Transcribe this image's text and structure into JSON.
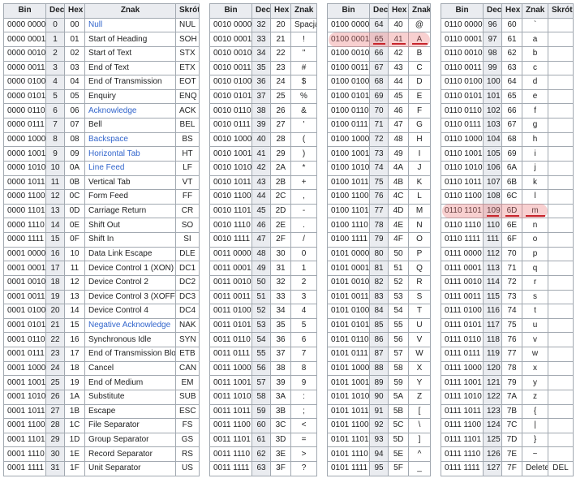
{
  "tables": [
    {
      "headers": [
        "Bin",
        "Dec",
        "Hex",
        "Znak",
        "Skrót"
      ],
      "rows": [
        [
          "0000 0000",
          "0",
          "00",
          "Null",
          "NUL"
        ],
        [
          "0000 0001",
          "1",
          "01",
          "Start of Heading",
          "SOH"
        ],
        [
          "0000 0010",
          "2",
          "02",
          "Start of Text",
          "STX"
        ],
        [
          "0000 0011",
          "3",
          "03",
          "End of Text",
          "ETX"
        ],
        [
          "0000 0100",
          "4",
          "04",
          "End of Transmission",
          "EOT"
        ],
        [
          "0000 0101",
          "5",
          "05",
          "Enquiry",
          "ENQ"
        ],
        [
          "0000 0110",
          "6",
          "06",
          "Acknowledge",
          "ACK"
        ],
        [
          "0000 0111",
          "7",
          "07",
          "Bell",
          "BEL"
        ],
        [
          "0000 1000",
          "8",
          "08",
          "Backspace",
          "BS"
        ],
        [
          "0000 1001",
          "9",
          "09",
          "Horizontal Tab",
          "HT"
        ],
        [
          "0000 1010",
          "10",
          "0A",
          "Line Feed",
          "LF"
        ],
        [
          "0000 1011",
          "11",
          "0B",
          "Vertical Tab",
          "VT"
        ],
        [
          "0000 1100",
          "12",
          "0C",
          "Form Feed",
          "FF"
        ],
        [
          "0000 1101",
          "13",
          "0D",
          "Carriage Return",
          "CR"
        ],
        [
          "0000 1110",
          "14",
          "0E",
          "Shift Out",
          "SO"
        ],
        [
          "0000 1111",
          "15",
          "0F",
          "Shift In",
          "SI"
        ],
        [
          "0001 0000",
          "16",
          "10",
          "Data Link Escape",
          "DLE"
        ],
        [
          "0001 0001",
          "17",
          "11",
          "Device Control 1 (XON)",
          "DC1"
        ],
        [
          "0001 0010",
          "18",
          "12",
          "Device Control 2",
          "DC2"
        ],
        [
          "0001 0011",
          "19",
          "13",
          "Device Control 3 (XOFF)",
          "DC3"
        ],
        [
          "0001 0100",
          "20",
          "14",
          "Device Control 4",
          "DC4"
        ],
        [
          "0001 0101",
          "21",
          "15",
          "Negative Acknowledge",
          "NAK"
        ],
        [
          "0001 0110",
          "22",
          "16",
          "Synchronous Idle",
          "SYN"
        ],
        [
          "0001 0111",
          "23",
          "17",
          "End of Transmission Block",
          "ETB"
        ],
        [
          "0001 1000",
          "24",
          "18",
          "Cancel",
          "CAN"
        ],
        [
          "0001 1001",
          "25",
          "19",
          "End of Medium",
          "EM"
        ],
        [
          "0001 1010",
          "26",
          "1A",
          "Substitute",
          "SUB"
        ],
        [
          "0001 1011",
          "27",
          "1B",
          "Escape",
          "ESC"
        ],
        [
          "0001 1100",
          "28",
          "1C",
          "File Separator",
          "FS"
        ],
        [
          "0001 1101",
          "29",
          "1D",
          "Group Separator",
          "GS"
        ],
        [
          "0001 1110",
          "30",
          "1E",
          "Record Separator",
          "RS"
        ],
        [
          "0001 1111",
          "31",
          "1F",
          "Unit Separator",
          "US"
        ]
      ],
      "linked_rows": [
        0,
        6,
        8,
        9,
        10,
        21
      ]
    },
    {
      "headers": [
        "Bin",
        "Dec",
        "Hex",
        "Znak"
      ],
      "rows": [
        [
          "0010 0000",
          "32",
          "20",
          "Spacja"
        ],
        [
          "0010 0001",
          "33",
          "21",
          "!"
        ],
        [
          "0010 0010",
          "34",
          "22",
          "\""
        ],
        [
          "0010 0011",
          "35",
          "23",
          "#"
        ],
        [
          "0010 0100",
          "36",
          "24",
          "$"
        ],
        [
          "0010 0101",
          "37",
          "25",
          "%"
        ],
        [
          "0010 0110",
          "38",
          "26",
          "&"
        ],
        [
          "0010 0111",
          "39",
          "27",
          "'"
        ],
        [
          "0010 1000",
          "40",
          "28",
          "("
        ],
        [
          "0010 1001",
          "41",
          "29",
          ")"
        ],
        [
          "0010 1010",
          "42",
          "2A",
          "*"
        ],
        [
          "0010 1011",
          "43",
          "2B",
          "+"
        ],
        [
          "0010 1100",
          "44",
          "2C",
          ","
        ],
        [
          "0010 1101",
          "45",
          "2D",
          "-"
        ],
        [
          "0010 1110",
          "46",
          "2E",
          "."
        ],
        [
          "0010 1111",
          "47",
          "2F",
          "/"
        ],
        [
          "0011 0000",
          "48",
          "30",
          "0"
        ],
        [
          "0011 0001",
          "49",
          "31",
          "1"
        ],
        [
          "0011 0010",
          "50",
          "32",
          "2"
        ],
        [
          "0011 0011",
          "51",
          "33",
          "3"
        ],
        [
          "0011 0100",
          "52",
          "34",
          "4"
        ],
        [
          "0011 0101",
          "53",
          "35",
          "5"
        ],
        [
          "0011 0110",
          "54",
          "36",
          "6"
        ],
        [
          "0011 0111",
          "55",
          "37",
          "7"
        ],
        [
          "0011 1000",
          "56",
          "38",
          "8"
        ],
        [
          "0011 1001",
          "57",
          "39",
          "9"
        ],
        [
          "0011 1010",
          "58",
          "3A",
          ":"
        ],
        [
          "0011 1011",
          "59",
          "3B",
          ";"
        ],
        [
          "0011 1100",
          "60",
          "3C",
          "<"
        ],
        [
          "0011 1101",
          "61",
          "3D",
          "="
        ],
        [
          "0011 1110",
          "62",
          "3E",
          ">"
        ],
        [
          "0011 1111",
          "63",
          "3F",
          "?"
        ]
      ],
      "linked_rows": []
    },
    {
      "headers": [
        "Bin",
        "Dec",
        "Hex",
        "Znak"
      ],
      "rows": [
        [
          "0100 0000",
          "64",
          "40",
          "@"
        ],
        [
          "0100 0001",
          "65",
          "41",
          "A"
        ],
        [
          "0100 0010",
          "66",
          "42",
          "B"
        ],
        [
          "0100 0011",
          "67",
          "43",
          "C"
        ],
        [
          "0100 0100",
          "68",
          "44",
          "D"
        ],
        [
          "0100 0101",
          "69",
          "45",
          "E"
        ],
        [
          "0100 0110",
          "70",
          "46",
          "F"
        ],
        [
          "0100 0111",
          "71",
          "47",
          "G"
        ],
        [
          "0100 1000",
          "72",
          "48",
          "H"
        ],
        [
          "0100 1001",
          "73",
          "49",
          "I"
        ],
        [
          "0100 1010",
          "74",
          "4A",
          "J"
        ],
        [
          "0100 1011",
          "75",
          "4B",
          "K"
        ],
        [
          "0100 1100",
          "76",
          "4C",
          "L"
        ],
        [
          "0100 1101",
          "77",
          "4D",
          "M"
        ],
        [
          "0100 1110",
          "78",
          "4E",
          "N"
        ],
        [
          "0100 1111",
          "79",
          "4F",
          "O"
        ],
        [
          "0101 0000",
          "80",
          "50",
          "P"
        ],
        [
          "0101 0001",
          "81",
          "51",
          "Q"
        ],
        [
          "0101 0010",
          "82",
          "52",
          "R"
        ],
        [
          "0101 0011",
          "83",
          "53",
          "S"
        ],
        [
          "0101 0100",
          "84",
          "54",
          "T"
        ],
        [
          "0101 0101",
          "85",
          "55",
          "U"
        ],
        [
          "0101 0110",
          "86",
          "56",
          "V"
        ],
        [
          "0101 0111",
          "87",
          "57",
          "W"
        ],
        [
          "0101 1000",
          "88",
          "58",
          "X"
        ],
        [
          "0101 1001",
          "89",
          "59",
          "Y"
        ],
        [
          "0101 1010",
          "90",
          "5A",
          "Z"
        ],
        [
          "0101 1011",
          "91",
          "5B",
          "["
        ],
        [
          "0101 1100",
          "92",
          "5C",
          "\\"
        ],
        [
          "0101 1101",
          "93",
          "5D",
          "]"
        ],
        [
          "0101 1110",
          "94",
          "5E",
          "^"
        ],
        [
          "0101 1111",
          "95",
          "5F",
          "_"
        ]
      ],
      "linked_rows": []
    },
    {
      "headers": [
        "Bin",
        "Dec",
        "Hex",
        "Znak",
        "Skrót"
      ],
      "rows": [
        [
          "0110 0000",
          "96",
          "60",
          "`",
          ""
        ],
        [
          "0110 0001",
          "97",
          "61",
          "a",
          ""
        ],
        [
          "0110 0010",
          "98",
          "62",
          "b",
          ""
        ],
        [
          "0110 0011",
          "99",
          "63",
          "c",
          ""
        ],
        [
          "0110 0100",
          "100",
          "64",
          "d",
          ""
        ],
        [
          "0110 0101",
          "101",
          "65",
          "e",
          ""
        ],
        [
          "0110 0110",
          "102",
          "66",
          "f",
          ""
        ],
        [
          "0110 0111",
          "103",
          "67",
          "g",
          ""
        ],
        [
          "0110 1000",
          "104",
          "68",
          "h",
          ""
        ],
        [
          "0110 1001",
          "105",
          "69",
          "i",
          ""
        ],
        [
          "0110 1010",
          "106",
          "6A",
          "j",
          ""
        ],
        [
          "0110 1011",
          "107",
          "6B",
          "k",
          ""
        ],
        [
          "0110 1100",
          "108",
          "6C",
          "l",
          ""
        ],
        [
          "0110 1101",
          "109",
          "6D",
          "m",
          ""
        ],
        [
          "0110 1110",
          "110",
          "6E",
          "n",
          ""
        ],
        [
          "0110 1111",
          "111",
          "6F",
          "o",
          ""
        ],
        [
          "0111 0000",
          "112",
          "70",
          "p",
          ""
        ],
        [
          "0111 0001",
          "113",
          "71",
          "q",
          ""
        ],
        [
          "0111 0010",
          "114",
          "72",
          "r",
          ""
        ],
        [
          "0111 0011",
          "115",
          "73",
          "s",
          ""
        ],
        [
          "0111 0100",
          "116",
          "74",
          "t",
          ""
        ],
        [
          "0111 0101",
          "117",
          "75",
          "u",
          ""
        ],
        [
          "0111 0110",
          "118",
          "76",
          "v",
          ""
        ],
        [
          "0111 0111",
          "119",
          "77",
          "w",
          ""
        ],
        [
          "0111 1000",
          "120",
          "78",
          "x",
          ""
        ],
        [
          "0111 1001",
          "121",
          "79",
          "y",
          ""
        ],
        [
          "0111 1010",
          "122",
          "7A",
          "z",
          ""
        ],
        [
          "0111 1011",
          "123",
          "7B",
          "{",
          ""
        ],
        [
          "0111 1100",
          "124",
          "7C",
          "|",
          ""
        ],
        [
          "0111 1101",
          "125",
          "7D",
          "}",
          ""
        ],
        [
          "0111 1110",
          "126",
          "7E",
          "~",
          ""
        ],
        [
          "0111 1111",
          "127",
          "7F",
          "Delete",
          "DEL"
        ]
      ],
      "linked_rows": []
    }
  ],
  "highlights": [
    {
      "table": 2,
      "row": 1
    },
    {
      "table": 3,
      "row": 13
    }
  ],
  "colors": {
    "link": "#3366cc",
    "highlight": "#ec7878",
    "underline": "#c8252c"
  }
}
